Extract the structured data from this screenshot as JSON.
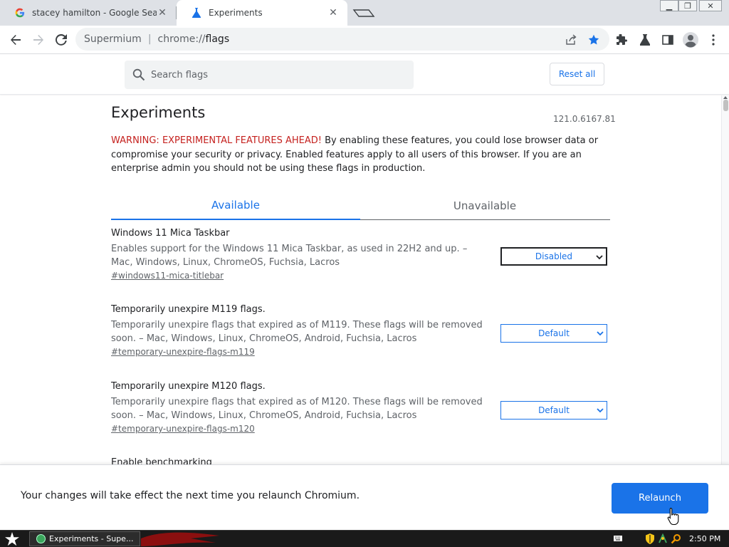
{
  "tabs": [
    {
      "title": "stacey hamilton - Google Search",
      "icon": "google-icon"
    },
    {
      "title": "Experiments",
      "icon": "flask-icon"
    }
  ],
  "window_controls": {
    "minimize": "▭",
    "restore": "❐",
    "close": "✕"
  },
  "omnibox": {
    "origin": "Supermium",
    "url_prefix": "chrome://",
    "url_page": "flags"
  },
  "search": {
    "placeholder": "Search flags"
  },
  "reset_all_label": "Reset all",
  "page": {
    "title": "Experiments",
    "version": "121.0.6167.81",
    "warning_label": "WARNING: EXPERIMENTAL FEATURES AHEAD!",
    "warning_text": " By enabling these features, you could lose browser data or compromise your security or privacy. Enabled features apply to all users of this browser. If you are an enterprise admin you should not be using these flags in production."
  },
  "flag_tabs": {
    "available": "Available",
    "unavailable": "Unavailable"
  },
  "flags": [
    {
      "name": "Windows 11 Mica Taskbar",
      "description": "Enables support for the Windows 11 Mica Taskbar, as used in 22H2 and up. – Mac, Windows, Linux, ChromeOS, Fuchsia, Lacros",
      "link": "#windows11-mica-titlebar",
      "value": "Disabled"
    },
    {
      "name": "Temporarily unexpire M119 flags.",
      "description": "Temporarily unexpire flags that expired as of M119. These flags will be removed soon. – Mac, Windows, Linux, ChromeOS, Android, Fuchsia, Lacros",
      "link": "#temporary-unexpire-flags-m119",
      "value": "Default"
    },
    {
      "name": "Temporarily unexpire M120 flags.",
      "description": "Temporarily unexpire flags that expired as of M120. These flags will be removed soon. – Mac, Windows, Linux, ChromeOS, Android, Fuchsia, Lacros",
      "link": "#temporary-unexpire-flags-m120",
      "value": "Default"
    },
    {
      "name": "Enable benchmarking"
    }
  ],
  "relaunch": {
    "message": "Your changes will take effect the next time you relaunch Chromium.",
    "button": "Relaunch"
  },
  "taskbar": {
    "app_label": "Experiments - Supe...",
    "clock": "2:50 PM"
  },
  "colors": {
    "accent": "#1a73e8",
    "warning": "#c5221f"
  }
}
